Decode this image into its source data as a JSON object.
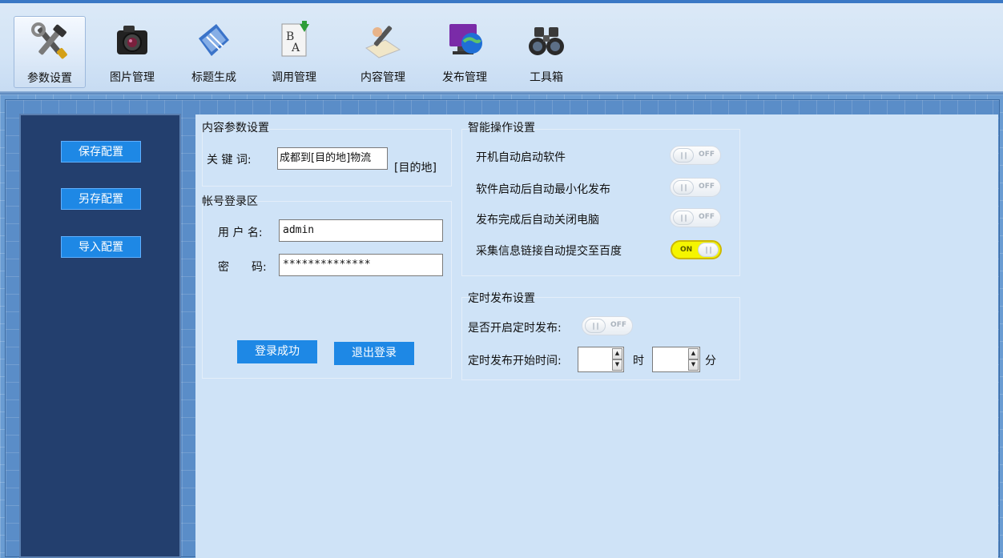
{
  "toolbar": {
    "items": [
      {
        "label": "参数设置",
        "icon": "tools-icon"
      },
      {
        "label": "图片管理",
        "icon": "camera-icon"
      },
      {
        "label": "标题生成",
        "icon": "notebook-icon"
      },
      {
        "label": "调用管理",
        "icon": "text-document-icon"
      },
      {
        "label": "内容管理",
        "icon": "pen-writing-icon"
      },
      {
        "label": "发布管理",
        "icon": "globe-monitor-icon"
      },
      {
        "label": "工具箱",
        "icon": "binoculars-icon"
      }
    ]
  },
  "sidebar": {
    "save": "保存配置",
    "save_as": "另存配置",
    "import": "导入配置"
  },
  "content_params": {
    "title": "内容参数设置",
    "keyword_label": "关 键 词:",
    "keyword_value": "成都到[目的地]物流",
    "keyword_tag": "[目的地]"
  },
  "login": {
    "title": "帐号登录区",
    "username_label": "用 户 名:",
    "username_value": "admin",
    "password_label_1": "密",
    "password_label_2": "码:",
    "password_value": "**************",
    "login_btn": "登录成功",
    "logout_btn": "退出登录"
  },
  "smart": {
    "title": "智能操作设置",
    "options": [
      {
        "label": "开机自动启动软件",
        "state": "OFF"
      },
      {
        "label": "软件启动后自动最小化发布",
        "state": "OFF"
      },
      {
        "label": "发布完成后自动关闭电脑",
        "state": "OFF"
      },
      {
        "label": "采集信息链接自动提交至百度",
        "state": "ON"
      }
    ]
  },
  "schedule": {
    "title": "定时发布设置",
    "enable_label": "是否开启定时发布:",
    "enable_state": "OFF",
    "start_label": "定时发布开始时间:",
    "hour_unit": "时",
    "minute_unit": "分",
    "hour_value": "",
    "minute_value": ""
  },
  "colors": {
    "accent_button": "#1e88e5",
    "sidebar_bg": "#233f6e",
    "panel_bg": "#cfe3f7",
    "toggle_on": "#f5f500"
  }
}
